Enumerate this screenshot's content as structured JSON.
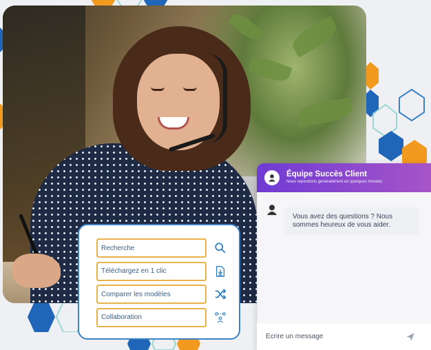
{
  "features": [
    {
      "label": "Recherche",
      "icon": "search-icon"
    },
    {
      "label": "Téléchargez en 1 clic",
      "icon": "download-file-icon"
    },
    {
      "label": "Comparer les modèles",
      "icon": "shuffle-icon"
    },
    {
      "label": "Collaboration",
      "icon": "team-icon"
    }
  ],
  "chat": {
    "title": "Équipe Succès Client",
    "subtitle": "Nous répondons généralement en quelques minutes",
    "message": "Vous avez des questions ? Nous sommes heureux de vous aider.",
    "input_placeholder": "Ecrire un message"
  },
  "colors": {
    "accent_blue": "#3b82c4",
    "pill_border": "#e7b24a",
    "chat_header_start": "#6f3bd4",
    "chat_header_end": "#a855c7"
  }
}
